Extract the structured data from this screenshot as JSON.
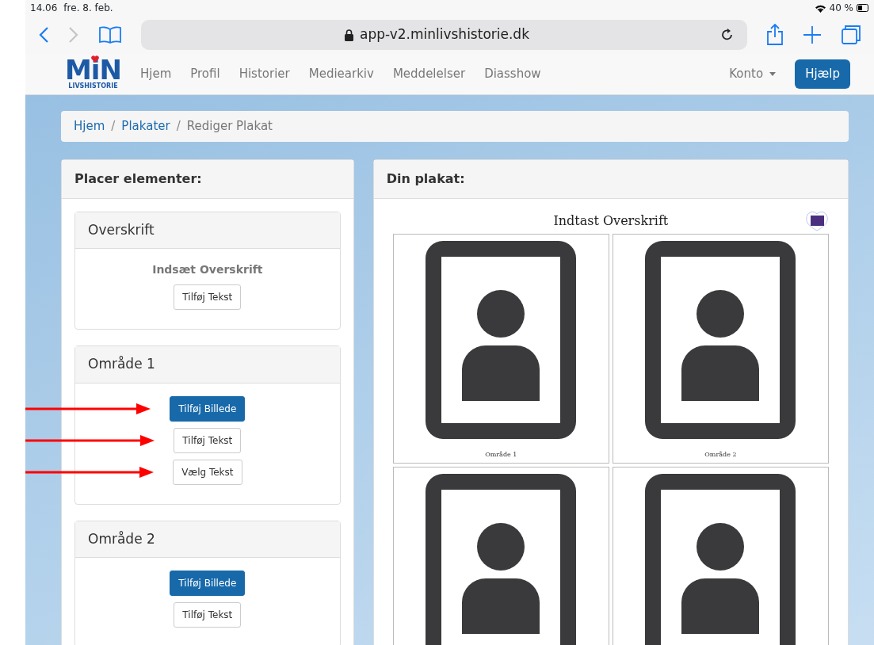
{
  "status_bar": {
    "time": "14.06",
    "date": "fre. 8. feb.",
    "battery": "40 %"
  },
  "browser": {
    "url": "app-v2.minlivshistorie.dk"
  },
  "navbar": {
    "logo": "MiN",
    "logo_subtitle": "LIVSHISTORIE",
    "links": [
      "Hjem",
      "Profil",
      "Historier",
      "Mediearkiv",
      "Meddelelser",
      "Diasshow"
    ],
    "account": "Konto",
    "help_button": "Hjælp"
  },
  "breadcrumb": [
    {
      "label": "Hjem",
      "current": false
    },
    {
      "separator": "/",
      "label": "Plakater",
      "current": false
    },
    {
      "separator": "/",
      "label": "Rediger Plakat",
      "current": true
    }
  ],
  "left_panel": {
    "title": "Placer elementer:",
    "sections": [
      {
        "title": "Overskrift",
        "items": [
          {
            "kind": "heading",
            "text": "Indsæt Overskrift"
          },
          {
            "kind": "button",
            "label": "Tilføj Tekst",
            "primary": false,
            "arrow": false
          }
        ]
      },
      {
        "title": "Område 1",
        "items": [
          {
            "kind": "button",
            "label": "Tilføj Billede",
            "primary": true,
            "arrow": true
          },
          {
            "kind": "button",
            "label": "Tilføj Tekst",
            "primary": false,
            "arrow": true
          },
          {
            "kind": "button",
            "label": "Vælg Tekst",
            "primary": false,
            "arrow": true
          }
        ]
      },
      {
        "title": "Område 2",
        "items": [
          {
            "kind": "button",
            "label": "Tilføj Billede",
            "primary": true,
            "arrow": false
          },
          {
            "kind": "button",
            "label": "Tilføj Tekst",
            "primary": false,
            "arrow": false
          }
        ]
      }
    ]
  },
  "right_panel": {
    "title": "Din plakat:",
    "poster": {
      "title": "Indtast Overskrift",
      "tiles": [
        {
          "kind": "portrait",
          "caption": "Område 1"
        },
        {
          "kind": "portrait",
          "caption": "Område 2"
        },
        {
          "kind": "portrait"
        },
        {
          "kind": "portrait"
        }
      ]
    }
  }
}
